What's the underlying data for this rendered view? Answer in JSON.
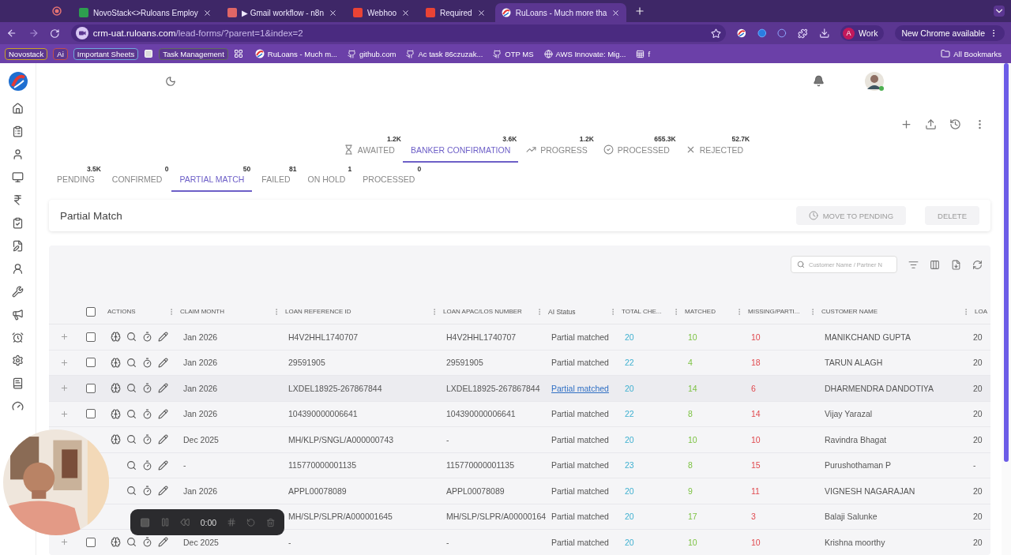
{
  "browser": {
    "tabs": [
      {
        "title": "NovoStack<>Ruloans Employ",
        "selected": false
      },
      {
        "title": "▶ Gmail workflow - n8n",
        "selected": false
      },
      {
        "title": "Webhoo",
        "selected": false
      },
      {
        "title": "Required",
        "selected": false
      },
      {
        "title": "RuLoans - Much more tha",
        "selected": true
      }
    ],
    "url": {
      "host": "crm-uat.ruloans.com",
      "path": "/lead-forms/?parent=1&index=2"
    },
    "profile": {
      "initial": "A",
      "name": "Work"
    },
    "update_button": "New Chrome available",
    "bookmarks": [
      {
        "kind": "chip",
        "label": "Novostack",
        "color": "#c9a227"
      },
      {
        "kind": "chip",
        "label": "Ai",
        "color": "#c0504d"
      },
      {
        "kind": "chip",
        "label": "Important Sheets",
        "color": "#6fa8dc"
      },
      {
        "kind": "icon"
      },
      {
        "kind": "chip",
        "label": "Task Management",
        "color": "#5f6b5f"
      },
      {
        "kind": "icon"
      },
      {
        "kind": "link",
        "label": "RuLoans - Much m..."
      },
      {
        "kind": "link",
        "label": "github.com"
      },
      {
        "kind": "link",
        "label": "Ac task 86czuzak..."
      },
      {
        "kind": "link",
        "label": "OTP MS"
      },
      {
        "kind": "link",
        "label": "AWS Innovate: Mig..."
      },
      {
        "kind": "link",
        "label": "f"
      }
    ],
    "all_bookmarks": "All Bookmarks"
  },
  "status_tabs": [
    {
      "label": "AWAITED",
      "count": "1.2K",
      "selected": false
    },
    {
      "label": "BANKER CONFIRMATION",
      "count": "3.6K",
      "selected": true
    },
    {
      "label": "PROGRESS",
      "count": "1.2K",
      "selected": false
    },
    {
      "label": "PROCESSED",
      "count": "655.3K",
      "selected": false
    },
    {
      "label": "REJECTED",
      "count": "52.7K",
      "selected": false
    }
  ],
  "sub_tabs": [
    {
      "label": "PENDING",
      "count": "3.5K",
      "selected": false
    },
    {
      "label": "CONFIRMED",
      "count": "0",
      "selected": false
    },
    {
      "label": "PARTIAL MATCH",
      "count": "50",
      "selected": true
    },
    {
      "label": "FAILED",
      "count": "81",
      "selected": false
    },
    {
      "label": "ON HOLD",
      "count": "1",
      "selected": false
    },
    {
      "label": "PROCESSED",
      "count": "0",
      "selected": false
    }
  ],
  "panel": {
    "title": "Partial Match",
    "buttons": [
      {
        "label": "MOVE TO PENDING",
        "disabled": true
      },
      {
        "label": "DELETE",
        "disabled": true
      }
    ]
  },
  "search": {
    "placeholder": "Customer Name / Partner N"
  },
  "table": {
    "all_checked": false,
    "actions_header": "ACTIONS",
    "columns": [
      "CLAIM MONTH",
      "LOAN REFERENCE ID",
      "LOAN APAC/LOS NUMBER",
      "AI Status",
      "TOTAL CHE...",
      "MATCHED",
      "MISSING/PARTI...",
      "CUSTOMER NAME",
      "LOA"
    ],
    "rows": [
      {
        "checked": false,
        "hovered": false,
        "cells": [
          "Jan 2026",
          "H4V2HHL1740707",
          "H4V2HHL1740707",
          "Partial matched",
          "20",
          "10",
          "10",
          "MANIKCHAND GUPTA",
          "20"
        ]
      },
      {
        "checked": false,
        "hovered": false,
        "cells": [
          "Jan 2026",
          "29591905",
          "29591905",
          "Partial matched",
          "22",
          "4",
          "18",
          "TARUN ALAGH",
          "20"
        ]
      },
      {
        "checked": false,
        "hovered": true,
        "cells": [
          "Jan 2026",
          "LXDEL18925-267867844",
          "LXDEL18925-267867844",
          "Partial matched",
          "20",
          "14",
          "6",
          "DHARMENDRA DANDOTIYA",
          "20"
        ]
      },
      {
        "checked": false,
        "hovered": false,
        "cells": [
          "Jan 2026",
          "104390000006641",
          "104390000006641",
          "Partial matched",
          "22",
          "8",
          "14",
          "Vijay Yarazal",
          "20"
        ]
      },
      {
        "hovered": false,
        "cells": [
          "Dec 2025",
          "MH/KLP/SNGL/A000000743",
          "-",
          "Partial matched",
          "20",
          "10",
          "10",
          "Ravindra Bhagat",
          "20"
        ]
      },
      {
        "hovered": false,
        "cells": [
          "-",
          "115770000001135",
          "115770000001135",
          "Partial matched",
          "23",
          "8",
          "15",
          "Purushothaman P",
          "-"
        ]
      },
      {
        "hovered": false,
        "cells": [
          "Jan 2026",
          "APPL00078089",
          "APPL00078089",
          "Partial matched",
          "20",
          "9",
          "11",
          "VIGNESH NAGARAJAN",
          "20"
        ]
      },
      {
        "hovered": false,
        "cells": [
          null,
          "MH/SLP/SLPR/A000001645",
          "MH/SLP/SLPR/A00000164",
          "Partial matched",
          "20",
          "17",
          "3",
          "Balaji Salunke",
          "20"
        ]
      },
      {
        "checked": false,
        "hovered": false,
        "cells": [
          "Dec 2025",
          "-",
          "-",
          "Partial matched",
          "20",
          "10",
          "10",
          "Krishna moorthy",
          "20"
        ]
      }
    ]
  },
  "recorder": {
    "time": "0:00"
  }
}
